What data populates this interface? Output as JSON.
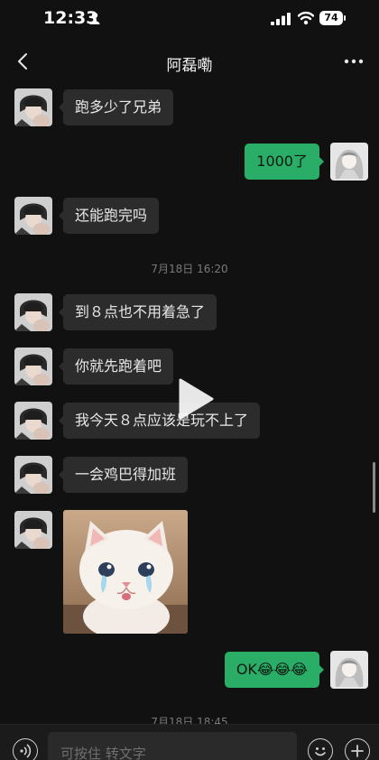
{
  "status_bar": {
    "time": "12:33",
    "battery": "74",
    "icons": [
      "person-icon",
      "signal-icon",
      "wifi-icon",
      "battery-icon"
    ]
  },
  "nav": {
    "title": "阿磊嘞",
    "icons": [
      "back-icon",
      "more-icon"
    ]
  },
  "messages": [
    {
      "side": "left",
      "text": "跑多少了兄弟"
    },
    {
      "side": "right",
      "text": "1000了"
    },
    {
      "side": "left",
      "text": "还能跑完吗"
    },
    {
      "side": "time",
      "text": "7月18日 16:20"
    },
    {
      "side": "left",
      "text": "到８点也不用着急了"
    },
    {
      "side": "left",
      "text": "你就先跑着吧"
    },
    {
      "side": "left",
      "text": "我今天８点应该是玩不上了"
    },
    {
      "side": "left",
      "text": "一会鸡巴得加班"
    },
    {
      "side": "left",
      "type": "image",
      "content": "crying-kitten-image"
    },
    {
      "side": "right",
      "text": "OK",
      "emoji": "😂😂😂"
    },
    {
      "side": "time",
      "text": "7月18日 18:45"
    }
  ],
  "input_bar": {
    "placeholder": "可按住 转文字",
    "icons": [
      "voice-icon",
      "emoji-icon",
      "add-icon"
    ]
  },
  "colors": {
    "background": "#111111",
    "bubble_incoming": "#2c2c2c",
    "bubble_outgoing": "#2aae67",
    "timestamp": "#7a7a7a"
  }
}
